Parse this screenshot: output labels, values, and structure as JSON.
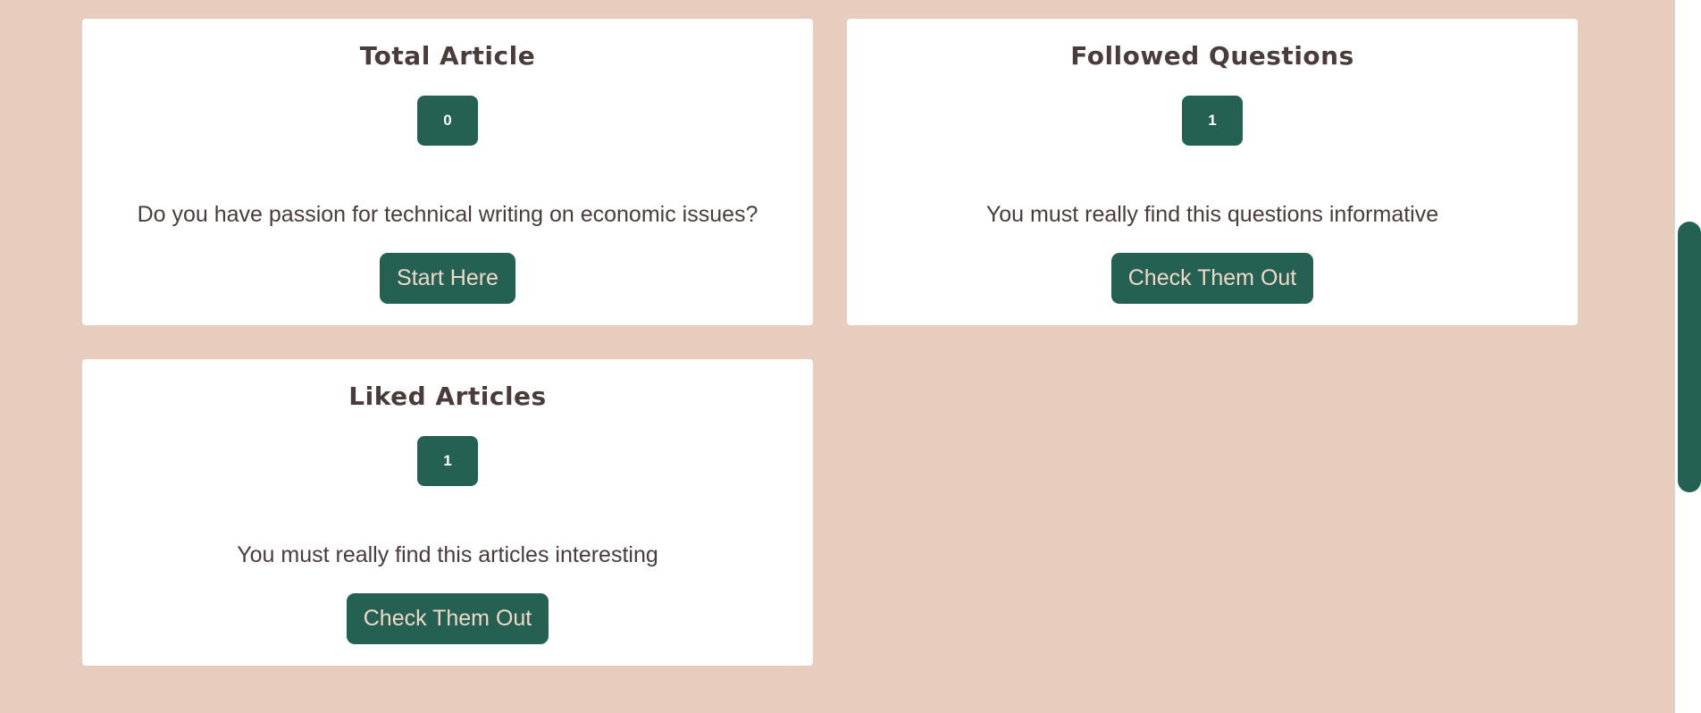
{
  "cards": [
    {
      "title": "Total Article",
      "count": "0",
      "description": "Do you have passion for technical writing on economic issues?",
      "button_label": "Start Here"
    },
    {
      "title": "Followed Questions",
      "count": "1",
      "description": "You must really find this questions informative",
      "button_label": "Check Them Out"
    },
    {
      "title": "Liked Articles",
      "count": "1",
      "description": "You must really find this articles interesting",
      "button_label": "Check Them Out"
    }
  ],
  "colors": {
    "page_background": "#e8cdbf",
    "card_background": "#ffffff",
    "accent_green": "#256152",
    "button_text": "#efd8c9",
    "text_dark": "#4a3c3b"
  }
}
